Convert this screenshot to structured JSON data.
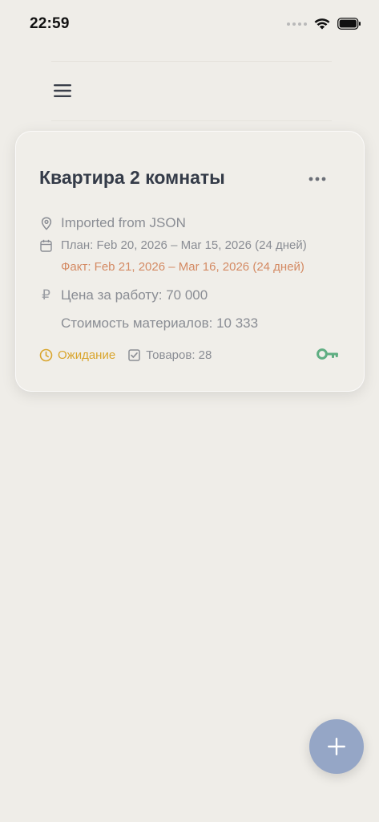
{
  "status_bar": {
    "time": "22:59",
    "icons": [
      "signal-dots-icon",
      "wifi-icon",
      "battery-icon"
    ]
  },
  "header": {
    "menu_icon": "hamburger-menu-icon"
  },
  "project_card": {
    "title": "Квартира 2 комнаты",
    "menu_icon": "more-horizontal-icon",
    "location": "Imported from JSON",
    "plan": "План: Feb 20, 2026 – Mar 15, 2026 (24 дней)",
    "fact": "Факт: Feb 21, 2026 – Mar 16, 2026 (24 дней)",
    "currency_symbol": "₽",
    "work_price": "Цена за работу: 70 000",
    "materials_cost": "Стоимость материалов: 10 333",
    "status": "Ожидание",
    "goods_count": "Товаров: 28",
    "key_icon": "key-icon"
  },
  "fab": {
    "icon": "plus-icon"
  },
  "colors": {
    "background": "#efede8",
    "card": "#f0eee9",
    "title": "#343b48",
    "muted_text": "#8a8d94",
    "fact_text": "#d48a63",
    "status_pending": "#d9a52d",
    "key_green": "#5fae82",
    "fab": "#95a6c6"
  }
}
